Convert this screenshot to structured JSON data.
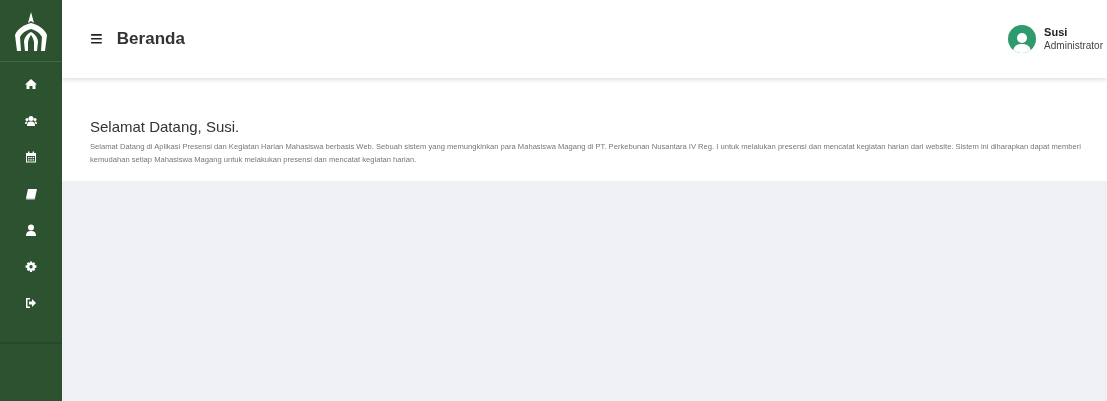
{
  "sidebar": {
    "items": [
      {
        "kind": "home"
      },
      {
        "kind": "users"
      },
      {
        "kind": "calendar"
      },
      {
        "kind": "book"
      },
      {
        "kind": "user"
      },
      {
        "kind": "gear"
      },
      {
        "kind": "logout"
      }
    ]
  },
  "header": {
    "menu_icon": "≡",
    "title": "Beranda",
    "user": {
      "name": "Susi",
      "role": "Administrator"
    }
  },
  "welcome": {
    "heading": "Selamat Datang, Susi.",
    "text": "Selamat Datang di Aplikasi Presensi dan Kegiatan Harian Mahasiswa berbasis Web. Sebuah sistem yang memungkinkan para Mahasiswa Magang di PT. Perkebunan Nusantara IV Reg. I untuk melalukan presensi dan mencatat kegiatan harian dari website. Sistem ini diharapkan dapat memberi kemudahan setiap Mahasiswa Magang untuk melakukan presensi dan mencatat kegiatan harian."
  }
}
